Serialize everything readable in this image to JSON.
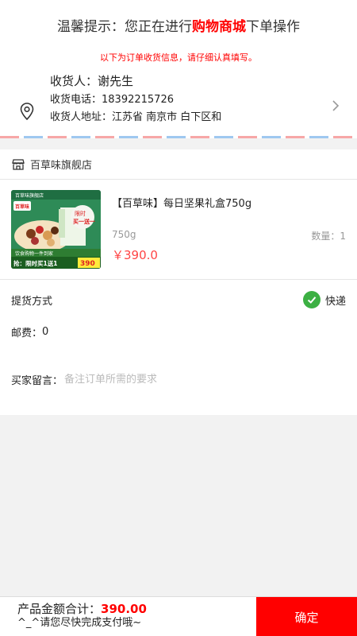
{
  "notice": {
    "prefix": "温馨提示：您正在进行",
    "highlight": "购物商城",
    "suffix": "下单操作"
  },
  "address": {
    "hint": "以下为订单收货信息，请仔细认真填写。",
    "name_label": "收货人：",
    "name": "谢先生",
    "phone_label": "收货电话：",
    "phone": "18392215726",
    "addr_label": "收货人地址：",
    "addr": "江苏省 南京市 白下区和"
  },
  "store": {
    "name": "百草味旗舰店"
  },
  "product": {
    "title": "【百草味】每日坚果礼盒750g",
    "spec": "750g",
    "qty": "数量：1",
    "price": "￥390.0",
    "image_texts": {
      "brand_logo": "百草味",
      "header": "百草味旗舰店",
      "badge_line1": "限时",
      "badge_line2": "买一送一",
      "banner_left": "饮食购物一件到家",
      "promo": "抢：限时买1送1",
      "promo_price": "390"
    }
  },
  "delivery": {
    "method_label": "提货方式",
    "method_value": "快递",
    "postage_label": "邮费：",
    "postage_value": "0",
    "message_label": "买家留言：",
    "message_placeholder": "备注订单所需的要求"
  },
  "footer": {
    "total_label": "产品金额合计：",
    "total_value": "390.00",
    "tip": "^_^请您尽快完成支付哦~",
    "confirm": "确定"
  },
  "colors": {
    "accent": "#ff0000",
    "price": "#ff4444",
    "check": "#3cb043"
  }
}
